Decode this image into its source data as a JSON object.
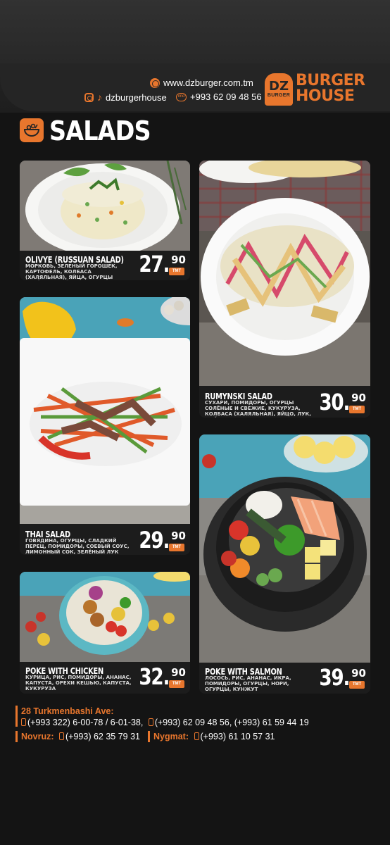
{
  "header": {
    "website": "www.dzburger.com.tm",
    "social": "dzburgerhouse",
    "phone": "+993 62 09 48 56",
    "logo_mark": "DZ",
    "logo_mark_sub": "BURGER",
    "logo_line1": "BURGER",
    "logo_line2": "HOUSE"
  },
  "section": {
    "title": "SALADS",
    "icon": "salad-bowl-icon"
  },
  "items": [
    {
      "name": "OLIVYE (RUSSUAN SALAD)",
      "description": "МОРКОВЬ, ЗЕЛЕНЫЙ ГОРОШЕК, КАРТОФЕЛЬ, КОЛБАСА (ХАЛЯЛЬНАЯ), ЯЙЦА, ОГУРЦЫ СОЛЁНЫЕ, МАЙОНЕЗ",
      "price_main": "27.",
      "price_cents": "90",
      "currency": "TMT"
    },
    {
      "name": "RUMYNSKI SALAD",
      "description": "СУХАРИ, ПОМИДОРЫ, ОГУРЦЫ СОЛЁНЫЕ И СВЕЖИЕ, КУКУРУЗА, КОЛБАСА (ХАЛЯЛЬНАЯ), ЯЙЦО, ЛУК, МАЙОНЕЗ, ЗЕЛЕНЬ",
      "price_main": "30.",
      "price_cents": "90",
      "currency": "TMT"
    },
    {
      "name": "THAI SALAD",
      "description": "ГОВЯДИНА, ОГУРЦЫ, СЛАДКИЙ ПЕРЕЦ, ПОМИДОРЫ, СОЕВЫЙ СОУС, ЛИМОННЫЙ СОК, ЗЕЛЁНЫЙ ЛУК",
      "price_main": "29.",
      "price_cents": "90",
      "currency": "TMT"
    },
    {
      "name": "POKE WITH SALMON",
      "description": "ЛОСОСЬ, РИС, АНАНАС, ИКРА, ПОМИДОРЫ, ОГУРЦЫ, НОРИ, ОГУРЦЫ, КУНЖУТ",
      "price_main": "39.",
      "price_cents": "90",
      "currency": "TMT"
    },
    {
      "name": "POKE WITH CHICKEN",
      "description": "КУРИЦА, РИС, ПОМИДОРЫ, АНАНАС, КАПУСТА, ОРЕХИ КЕШЬЮ, КАПУСТА, КУКУРУЗА",
      "price_main": "32.",
      "price_cents": "90",
      "currency": "TMT"
    }
  ],
  "footer": {
    "address": "28 Turkmenbashi Ave:",
    "landline": "(+993 322) 6-00-78 / 6-01-38,",
    "mobiles": "(+993) 62 09 48 56, (+993) 61 59 44 19",
    "branch1_label": "Novruz:",
    "branch1_phone": "(+993) 62 35 79 31",
    "branch2_label": "Nygmat:",
    "branch2_phone": "(+993) 61 10 57 31"
  },
  "colors": {
    "accent": "#e8762d",
    "background": "#141414",
    "card": "#1c1c1c"
  }
}
